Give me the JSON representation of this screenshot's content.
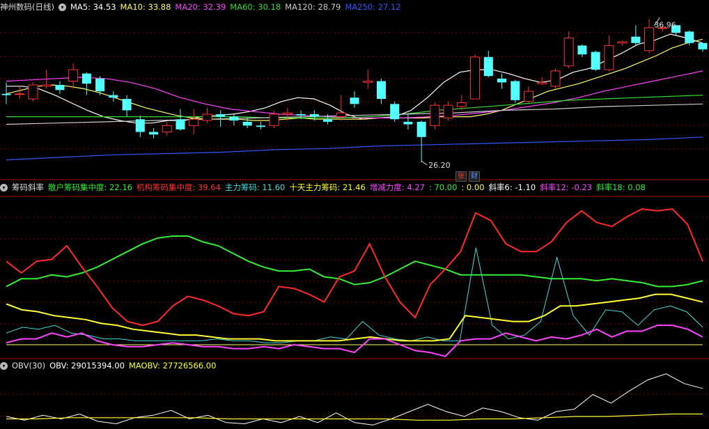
{
  "main_panel": {
    "title": "神州数码(日线)",
    "ma": [
      {
        "label": "MA5: 34.53",
        "color": "#ffffff"
      },
      {
        "label": "MA10: 33.88",
        "color": "#ffff66"
      },
      {
        "label": "MA20: 32.39",
        "color": "#ff44ff"
      },
      {
        "label": "MA60: 30.18",
        "color": "#33dd33"
      },
      {
        "label": "MA120: 28.79",
        "color": "#cccccc"
      },
      {
        "label": "MA250: 27.12",
        "color": "#3355ff"
      }
    ],
    "high_label": "36.96",
    "low_label": "26.20",
    "tag_zhang": "张",
    "tag_cai": "财"
  },
  "mid_panel": {
    "title": "筹码斜率",
    "items": [
      {
        "label": "散户筹码集中度: 22.16",
        "color": "#33ee33"
      },
      {
        "label": "机构筹码集中度: 39.64",
        "color": "#ff3333"
      },
      {
        "label": "主力筹码: 11.60",
        "color": "#44dddd"
      },
      {
        "label": "十天主力筹码: 21.46",
        "color": "#ffff33"
      },
      {
        "label": "增减力度: 4.27",
        "color": "#ff44ff"
      },
      {
        "label": ": 70.00",
        "color": "#33ee33"
      },
      {
        "label": ": 0.00",
        "color": "#ffff33"
      },
      {
        "label": "斜率6: -1.10",
        "color": "#ffffff"
      },
      {
        "label": "斜率12: -0.23",
        "color": "#ff44ff"
      },
      {
        "label": "斜率18: 0.08",
        "color": "#33ee33"
      }
    ]
  },
  "obv_panel": {
    "title": "OBV(30)",
    "items": [
      {
        "label": "OBV: 29015394.00",
        "color": "#ffffff"
      },
      {
        "label": "MAOBV: 27726566.00",
        "color": "#ffff33"
      }
    ]
  },
  "chart_data": [
    {
      "type": "candlestick",
      "title": "神州数码(日线)",
      "ylim": [
        25.5,
        38
      ],
      "candles": [
        [
          31.6,
          31.5,
          32.5,
          30.8
        ],
        [
          31.6,
          31.6,
          32.2,
          31.2
        ],
        [
          31.2,
          32.3,
          32.5,
          31.0
        ],
        [
          32.2,
          32.3,
          33.5,
          32.0
        ],
        [
          32.3,
          31.9,
          32.6,
          31.6
        ],
        [
          32.6,
          33.5,
          34.0,
          32.0
        ],
        [
          33.2,
          32.4,
          33.3,
          31.5
        ],
        [
          32.8,
          31.8,
          33.0,
          31.5
        ],
        [
          31.5,
          31.3,
          31.8,
          31.0
        ],
        [
          31.2,
          30.3,
          31.5,
          29.8
        ],
        [
          29.6,
          28.6,
          29.9,
          28.2
        ],
        [
          28.6,
          28.4,
          28.9,
          28.1
        ],
        [
          28.6,
          29.1,
          29.4,
          28.3
        ],
        [
          29.6,
          28.8,
          30.4,
          28.7
        ],
        [
          29.1,
          29.6,
          30.4,
          28.4
        ],
        [
          29.5,
          30.0,
          30.5,
          29.3
        ],
        [
          30.0,
          29.8,
          30.3,
          29.0
        ],
        [
          29.8,
          29.5,
          30.0,
          29.1
        ],
        [
          29.4,
          29.1,
          29.7,
          28.9
        ],
        [
          29.1,
          29.0,
          29.4,
          28.8
        ],
        [
          29.1,
          30.0,
          30.3,
          28.9
        ],
        [
          30.0,
          30.1,
          30.5,
          29.5
        ],
        [
          30.0,
          29.9,
          30.3,
          29.6
        ],
        [
          30.0,
          29.8,
          30.3,
          29.5
        ],
        [
          29.6,
          29.4,
          30.0,
          29.2
        ],
        [
          29.8,
          30.1,
          31.5,
          29.5
        ],
        [
          31.3,
          30.8,
          31.8,
          30.5
        ],
        [
          32.5,
          32.6,
          33.5,
          32.0
        ],
        [
          32.6,
          31.2,
          32.8,
          30.8
        ],
        [
          30.8,
          29.6,
          31.0,
          29.4
        ],
        [
          29.4,
          29.2,
          30.0,
          28.8
        ],
        [
          29.4,
          28.2,
          29.5,
          26.2
        ],
        [
          29.1,
          30.7,
          30.9,
          28.8
        ],
        [
          29.7,
          30.7,
          31.0,
          29.5
        ],
        [
          30.6,
          30.9,
          31.5,
          30.3
        ],
        [
          31.2,
          34.5,
          34.7,
          31.2
        ],
        [
          34.5,
          33.0,
          35.0,
          32.9
        ],
        [
          32.8,
          32.5,
          33.2,
          32.0
        ],
        [
          32.6,
          31.1,
          32.7,
          30.9
        ],
        [
          31.0,
          31.8,
          32.2,
          30.9
        ],
        [
          32.4,
          32.5,
          32.9,
          32.3
        ],
        [
          32.2,
          33.4,
          33.6,
          32.0
        ],
        [
          33.8,
          36.0,
          36.5,
          33.6
        ],
        [
          35.4,
          34.7,
          35.5,
          34.5
        ],
        [
          34.9,
          33.5,
          35.0,
          33.4
        ],
        [
          33.5,
          35.4,
          36.2,
          33.4
        ],
        [
          35.6,
          35.7,
          35.8,
          35.4
        ],
        [
          36.1,
          35.6,
          37.0,
          35.4
        ],
        [
          35.0,
          36.8,
          37.5,
          34.8
        ],
        [
          36.8,
          36.8,
          36.96,
          36.5
        ],
        [
          37.0,
          36.4,
          37.0,
          36.2
        ],
        [
          36.5,
          35.6,
          36.6,
          35.4
        ],
        [
          35.6,
          35.1,
          35.6,
          34.9
        ]
      ],
      "series": [
        {
          "name": "MA5",
          "values": [
            32.2,
            32.2,
            32.0,
            31.5,
            30.9,
            30.3,
            29.8,
            29.5,
            29.3,
            29.3,
            29.5,
            29.5,
            29.8,
            29.9,
            30.0,
            30.2,
            30.5,
            31.0,
            31.3,
            31.2,
            30.7,
            30.0,
            29.6,
            29.7,
            29.8,
            30.3,
            31.3,
            32.5,
            33.3,
            33.5,
            33.5,
            33.2,
            32.8,
            32.5,
            32.7,
            33.3,
            33.6,
            34.2,
            34.8,
            35.5,
            35.8,
            36.3,
            36.0,
            35.6
          ]
        },
        {
          "name": "MA10",
          "values": [
            31.6,
            31.9,
            32.2,
            32.3,
            32.2,
            32.0,
            31.7,
            31.3,
            30.9,
            30.5,
            30.2,
            29.9,
            29.7,
            29.6,
            29.6,
            29.6,
            29.5,
            29.5,
            29.6,
            29.7,
            29.6,
            29.6,
            29.6,
            29.6,
            29.7,
            29.7,
            29.7,
            29.7,
            29.8,
            29.8,
            29.8,
            30.0,
            30.3,
            30.8,
            31.3,
            31.8,
            32.1,
            32.4,
            32.8,
            33.2,
            33.6,
            34.1,
            34.6,
            35.2,
            35.6,
            35.9
          ]
        },
        {
          "name": "MA20",
          "values": [
            32.6,
            32.7,
            32.8,
            32.9,
            32.8,
            32.5,
            32.0,
            31.3,
            30.8,
            30.4,
            30.2,
            30.0,
            29.9,
            29.8,
            29.7,
            29.7,
            29.7,
            29.8,
            29.9,
            30.1,
            30.3,
            30.6,
            30.9,
            31.3,
            31.8,
            32.2,
            32.6,
            33.0,
            33.4
          ]
        },
        {
          "name": "MA60",
          "values": [
            29.8,
            29.8,
            29.8,
            29.8,
            29.8,
            29.8,
            29.8,
            29.8,
            29.7,
            29.7,
            29.7,
            29.8,
            30.0,
            30.3,
            30.5,
            30.7,
            30.9,
            31.1,
            31.2,
            31.3,
            31.4,
            31.5
          ]
        },
        {
          "name": "MA120",
          "values": [
            29.2,
            29.3,
            29.4,
            29.5,
            29.6,
            29.7,
            29.8,
            29.9,
            30.0,
            30.1,
            30.3,
            30.4,
            30.6,
            30.7,
            30.8
          ]
        },
        {
          "name": "MA250",
          "values": [
            26.4,
            26.6,
            26.8,
            26.9,
            27.0,
            27.2,
            27.3,
            27.5,
            27.6,
            27.7,
            27.8,
            27.9,
            28.0,
            28.2
          ]
        }
      ]
    },
    {
      "type": "line",
      "title": "筹码斜率",
      "ylim": [
        0,
        70
      ],
      "series": [
        {
          "name": "散户筹码集中度",
          "values": [
            30,
            34,
            34,
            36,
            35,
            37,
            40,
            44,
            48,
            52,
            55,
            56,
            56,
            53,
            51,
            47,
            43,
            40,
            38,
            38,
            39,
            35,
            34,
            31,
            32,
            35,
            39,
            43,
            41,
            39,
            36,
            36,
            36,
            36,
            36,
            35,
            34,
            34,
            34,
            33,
            34,
            33,
            32,
            30,
            30,
            31,
            33
          ]
        },
        {
          "name": "机构筹码集中度",
          "values": [
            43,
            37,
            43,
            44,
            51,
            40,
            30,
            19,
            12,
            10,
            12,
            20,
            25,
            23,
            20,
            16,
            15,
            17,
            30,
            29,
            26,
            22,
            35,
            38,
            52,
            35,
            22,
            14,
            31,
            39,
            48,
            68,
            64,
            52,
            48,
            48,
            53,
            63,
            69,
            63,
            61,
            66,
            70,
            69,
            70,
            62,
            43
          ]
        },
        {
          "name": "主力筹码",
          "values": [
            6,
            9,
            8,
            10,
            6,
            5,
            3,
            3,
            2,
            2,
            2,
            2,
            2,
            3,
            2,
            2,
            1,
            1,
            2,
            2,
            4,
            3,
            12,
            5,
            3,
            2,
            4,
            2,
            2,
            50,
            10,
            3,
            5,
            12,
            45,
            15,
            5,
            18,
            17,
            10,
            18,
            20,
            17,
            9
          ]
        },
        {
          "name": "十天主力筹码",
          "values": [
            21,
            18,
            17,
            15,
            14,
            13,
            11,
            10,
            8,
            7,
            6,
            5,
            5,
            4,
            3,
            3,
            3,
            2,
            2,
            2,
            2,
            2,
            3,
            4,
            3,
            2,
            2,
            2,
            3,
            15,
            14,
            13,
            12,
            12,
            15,
            20,
            20,
            21,
            22,
            23,
            24,
            26,
            26,
            24,
            22
          ]
        },
        {
          "name": "增减力度",
          "values": [
            1,
            3,
            3,
            6,
            4,
            6,
            2,
            0,
            -1,
            -1,
            0,
            1,
            0,
            -1,
            -1,
            -2,
            -2,
            -1,
            -2,
            0,
            -1,
            -2,
            -2,
            -4,
            3,
            3,
            0,
            -3,
            -4,
            -6,
            2,
            3,
            3,
            6,
            4,
            2,
            4,
            3,
            5,
            8,
            4,
            7,
            7,
            10,
            10,
            8,
            4
          ]
        }
      ]
    },
    {
      "type": "line",
      "title": "OBV(30)",
      "series": [
        {
          "name": "OBV",
          "values": [
            27.5,
            27.2,
            27.6,
            27.3,
            27.7,
            27.1,
            26.9,
            27.4,
            27.6,
            28.0,
            27.3,
            27.6,
            27.0,
            26.9,
            27.3,
            27.0,
            27.5,
            27.0,
            27.8,
            27.0,
            26.8,
            27.3,
            27.9,
            28.5,
            27.9,
            27.5,
            28.2,
            27.9,
            27.4,
            27.2,
            27.9,
            28.1,
            29.3,
            28.6,
            29.6,
            30.5,
            31.0,
            30.2,
            29.8
          ]
        },
        {
          "name": "MAOBV",
          "values": [
            27.3,
            27.3,
            27.4,
            27.4,
            27.4,
            27.4,
            27.4,
            27.3,
            27.3,
            27.3,
            27.3,
            27.3,
            27.3,
            27.2,
            27.2,
            27.3,
            27.3,
            27.4,
            27.5,
            27.5,
            27.6,
            27.7,
            27.7
          ]
        }
      ]
    }
  ]
}
